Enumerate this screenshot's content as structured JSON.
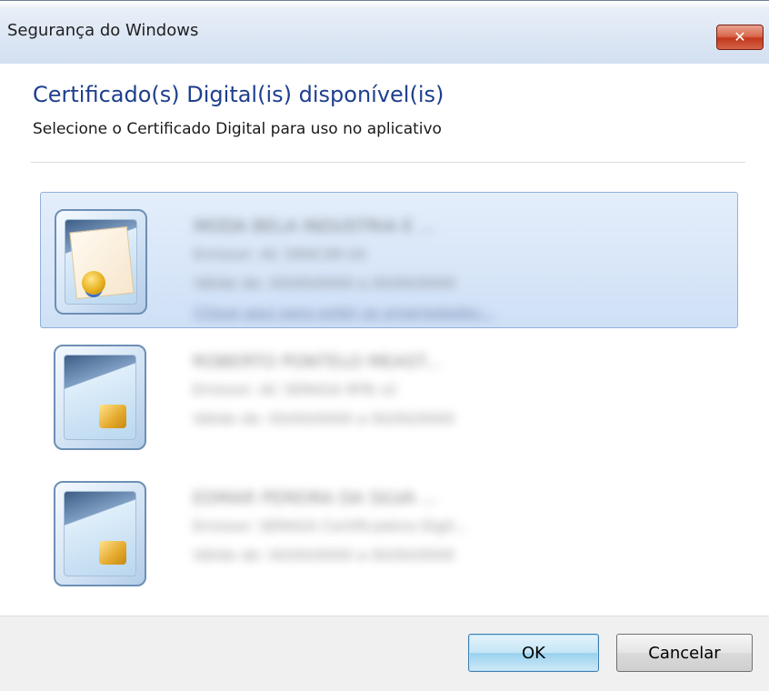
{
  "window": {
    "title": "Segurança do Windows",
    "close_label": "✕"
  },
  "header": {
    "title": "Certificado(s) Digital(is) disponível(is)",
    "subtitle": "Selecione o Certificado Digital para uso no aplicativo"
  },
  "certificates": [
    {
      "name": "MODA BELA INDUSTRIA E ...",
      "issuer": "Emissor: AC SRACSR-S4",
      "validity": "Válido de: 00/00/0000 a 00/00/0000",
      "link": "Clique aqui para exibir as propriedades...",
      "selected": true,
      "icon": "certificate-icon"
    },
    {
      "name": "ROBERTO PONTELO MEAST...",
      "issuer": "Emissor: AC SERASA RFB v2",
      "validity": "Válido de: 00/00/0000 a 00/00/0000",
      "selected": false,
      "icon": "smartcard-icon"
    },
    {
      "name": "EDMAR PEREIRA DA SILVA ...",
      "issuer": "Emissor: SERASA Certificadora Digit...",
      "validity": "Válido de: 00/00/0000 a 00/00/0000",
      "selected": false,
      "icon": "smartcard-icon"
    }
  ],
  "footer": {
    "ok_label": "OK",
    "cancel_label": "Cancelar"
  },
  "colors": {
    "title_blue": "#1e3f8f",
    "selection_bg": "#cfe0f6",
    "selection_border": "#8fb1da",
    "close_red": "#c2381c"
  }
}
